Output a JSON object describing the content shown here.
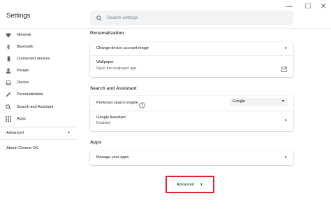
{
  "window": {
    "title": "Settings",
    "minimize": "—",
    "maximize": "☐",
    "close": "✕"
  },
  "search": {
    "placeholder": "Search settings",
    "icon": "search-icon"
  },
  "sidebar": {
    "items": [
      {
        "label": "Network",
        "icon": "wifi-icon"
      },
      {
        "label": "Bluetooth",
        "icon": "bluetooth-icon"
      },
      {
        "label": "Connected devices",
        "icon": "phone-icon"
      },
      {
        "label": "People",
        "icon": "person-icon"
      },
      {
        "label": "Device",
        "icon": "laptop-icon"
      },
      {
        "label": "Personalization",
        "icon": "pencil-icon"
      },
      {
        "label": "Search and Assistant",
        "icon": "search-icon"
      },
      {
        "label": "Apps",
        "icon": "apps-grid-icon"
      }
    ],
    "advanced": {
      "label": "Advanced",
      "caret": "▼"
    },
    "about": {
      "label": "About Chrome OS"
    }
  },
  "main": {
    "personalization": {
      "title": "Personalization",
      "rows": [
        {
          "label": "Change device account image",
          "arrow": "▸"
        },
        {
          "label": "Wallpaper",
          "sublabel": "Open the wallpaper app",
          "icon": "open-in-new-icon"
        }
      ]
    },
    "search_assistant": {
      "title": "Search and Assistant",
      "preferred_engine": {
        "label": "Preferred search engine",
        "help_icon": "help-icon",
        "value": "Google",
        "caret": "▼"
      },
      "assistant": {
        "label": "Google Assistant",
        "sublabel": "Enabled",
        "arrow": "▸"
      }
    },
    "apps": {
      "title": "Apps",
      "rows": [
        {
          "label": "Manage your apps",
          "arrow": "▸"
        }
      ]
    },
    "advanced_button": {
      "label": "Advanced",
      "caret": "▼",
      "highlight_color": "#e0242b"
    }
  },
  "colors": {
    "background": "#ffffff",
    "text": "#202124",
    "secondary_text": "#5f6368",
    "search_bg": "#f1f3f4",
    "highlight": "#e0242b"
  }
}
